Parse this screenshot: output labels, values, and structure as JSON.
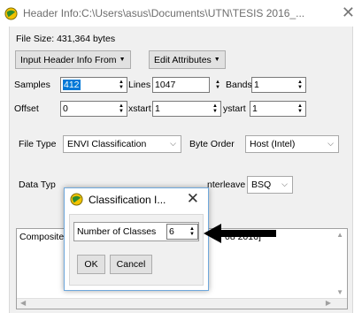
{
  "window": {
    "title": "Header Info:C:\\Users\\asus\\Documents\\UTN\\TESIS 2016_...",
    "close_glyph": "✕"
  },
  "info": {
    "file_size": "File Size: 431,364 bytes"
  },
  "toolbar": {
    "input_header_label": "Input Header Info From",
    "edit_attributes_label": "Edit Attributes"
  },
  "dims": {
    "samples_label": "Samples",
    "samples_value": "412",
    "lines_label": "Lines",
    "lines_value": "1047",
    "bands_label": "Bands",
    "bands_value": "1"
  },
  "offsets": {
    "offset_label": "Offset",
    "offset_value": "0",
    "xstart_label": "xstart",
    "xstart_value": "1",
    "ystart_label": "ystart",
    "ystart_value": "1"
  },
  "filetype": {
    "label": "File Type",
    "value": "ENVI Classification",
    "byte_order_label": "Byte Order",
    "byte_order_value": "Host (Intel)"
  },
  "datatype": {
    "label": "Data Typ",
    "interleave_label": "nterleave",
    "interleave_value": "BSQ"
  },
  "description": {
    "text_left": "Composite",
    "text_right": "08 2016]"
  },
  "dialog": {
    "title": "Classification I...",
    "close_glyph": "✕",
    "num_classes_label": "Number of Classes",
    "num_classes_value": "6",
    "ok_label": "OK",
    "cancel_label": "Cancel"
  },
  "icons": {
    "app": "envi-globe-icon",
    "arrow": "black-arrow-pointer"
  },
  "colors": {
    "selection": "#0078d7",
    "dialog_border": "#6fa8dc",
    "panel_bg": "#f0f0f0"
  }
}
